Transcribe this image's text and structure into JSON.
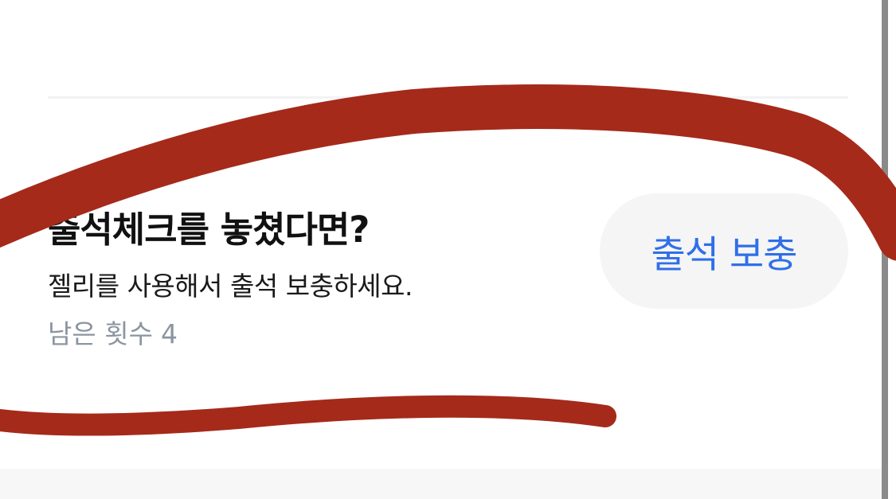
{
  "attendance_section": {
    "title": "출석체크를 놓쳤다면?",
    "description": "젤리를 사용해서 출석 보충하세요.",
    "remaining_label": "남은 횟수",
    "remaining_count": "4",
    "supplement_button_label": "출석 보충"
  },
  "colors": {
    "accent_blue": "#2f6fe8",
    "annotation_red": "#a52a1a",
    "muted_gray": "#8b95a1"
  }
}
